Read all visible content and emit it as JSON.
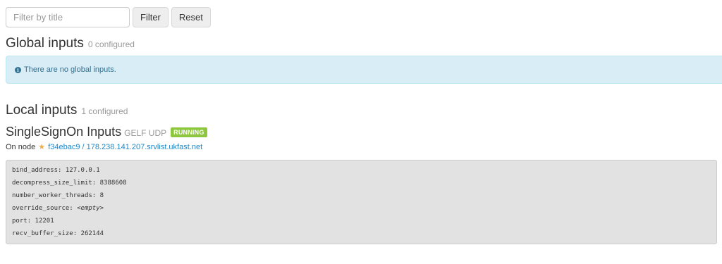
{
  "filter": {
    "placeholder": "Filter by title",
    "filter_label": "Filter",
    "reset_label": "Reset"
  },
  "global_inputs": {
    "title": "Global inputs",
    "count": "0 configured",
    "alert_icon": "info-icon",
    "alert_text": "There are no global inputs."
  },
  "local_inputs": {
    "title": "Local inputs",
    "count": "1 configured"
  },
  "input": {
    "title": "SingleSignOn Inputs",
    "type": "GELF UDP",
    "status": "RUNNING",
    "status_color": "#8dc63f",
    "node_prefix": "On node",
    "node_icon": "star-icon",
    "node_link": "f34ebac9 / 178.238.141.207.srvlist.ukfast.net",
    "config": [
      {
        "key": "bind_address",
        "value": "127.0.0.1"
      },
      {
        "key": "decompress_size_limit",
        "value": "8388608"
      },
      {
        "key": "number_worker_threads",
        "value": "8"
      },
      {
        "key": "override_source",
        "value": "<empty>"
      },
      {
        "key": "port",
        "value": "12201"
      },
      {
        "key": "recv_buffer_size",
        "value": "262144"
      }
    ]
  },
  "colors": {
    "alert_bg": "#d9edf7",
    "alert_text": "#31708f",
    "link": "#1e88c7",
    "config_bg": "#e2e2e2"
  }
}
